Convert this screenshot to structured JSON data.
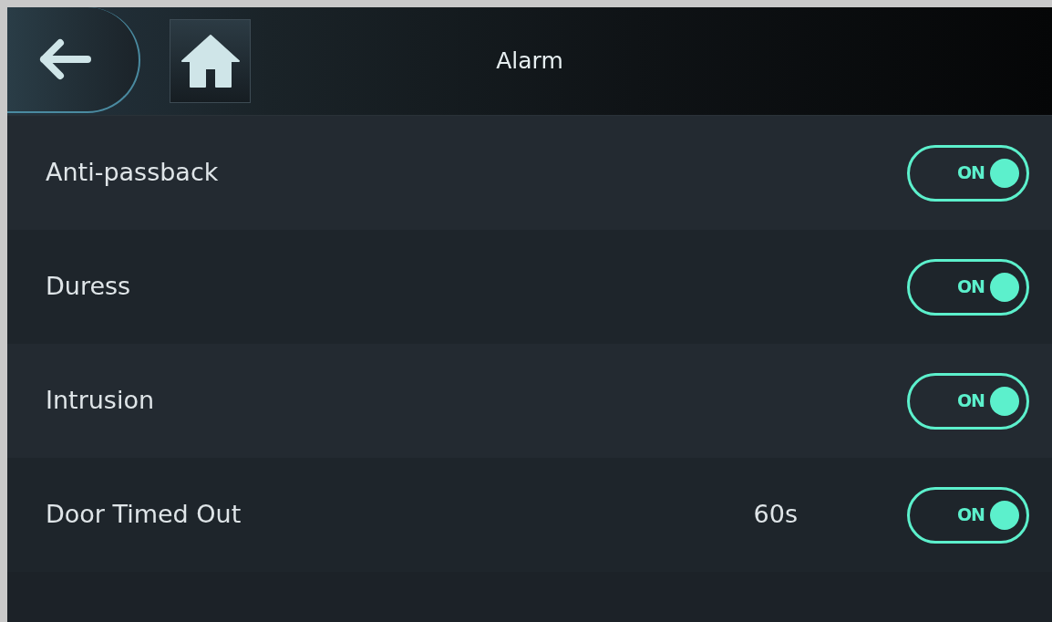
{
  "header": {
    "title": "Alarm"
  },
  "settings": [
    {
      "label": "Anti-passback",
      "on": true,
      "switch_text": "ON"
    },
    {
      "label": "Duress",
      "on": true,
      "switch_text": "ON"
    },
    {
      "label": "Intrusion",
      "on": true,
      "switch_text": "ON"
    },
    {
      "label": "Door Timed Out",
      "value": "60s",
      "on": true,
      "switch_text": "ON"
    }
  ]
}
